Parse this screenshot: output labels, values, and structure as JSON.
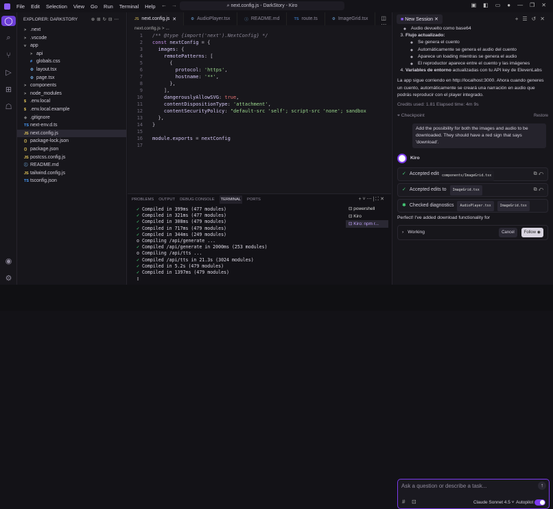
{
  "titlebar": {
    "menu": [
      "File",
      "Edit",
      "Selection",
      "View",
      "Go",
      "Run",
      "Terminal",
      "Help"
    ],
    "search": "next.config.js - DarkStory - Kiro"
  },
  "explorer": {
    "title": "EXPLORER: DARKSTORY",
    "items": [
      {
        "label": ".next",
        "icon": ">",
        "d": 0
      },
      {
        "label": ".vscode",
        "icon": ">",
        "d": 0
      },
      {
        "label": "app",
        "icon": "v",
        "d": 0
      },
      {
        "label": "api",
        "icon": ">",
        "d": 1
      },
      {
        "label": "globals.css",
        "icon": "#",
        "d": 1
      },
      {
        "label": "layout.tsx",
        "icon": "⚙",
        "d": 1
      },
      {
        "label": "page.tsx",
        "icon": "⚙",
        "d": 1
      },
      {
        "label": "components",
        "icon": ">",
        "d": 0
      },
      {
        "label": "node_modules",
        "icon": ">",
        "d": 0
      },
      {
        "label": ".env.local",
        "icon": "$",
        "d": 0
      },
      {
        "label": ".env.local.example",
        "icon": "$",
        "d": 0
      },
      {
        "label": ".gitignore",
        "icon": "◆",
        "d": 0
      },
      {
        "label": "next-env.d.ts",
        "icon": "TS",
        "d": 0
      },
      {
        "label": "next.config.js",
        "icon": "JS",
        "d": 0,
        "sel": true
      },
      {
        "label": "package-lock.json",
        "icon": "{}",
        "d": 0
      },
      {
        "label": "package.json",
        "icon": "{}",
        "d": 0
      },
      {
        "label": "postcss.config.js",
        "icon": "JS",
        "d": 0
      },
      {
        "label": "README.md",
        "icon": "ⓘ",
        "d": 0
      },
      {
        "label": "tailwind.config.js",
        "icon": "JS",
        "d": 0
      },
      {
        "label": "tsconfig.json",
        "icon": "TS",
        "d": 0
      }
    ]
  },
  "editor": {
    "tabs": [
      {
        "label": "next.config.js",
        "icon": "JS",
        "active": true
      },
      {
        "label": "AudioPlayer.tsx",
        "icon": "⚙"
      },
      {
        "label": "README.md",
        "icon": "ⓘ"
      },
      {
        "label": "route.ts",
        "icon": "TS"
      },
      {
        "label": "ImageGrid.tsx",
        "icon": "⚙"
      }
    ],
    "breadcrumb": "next.config.js > ...",
    "lines": [
      [
        [
          "c",
          "/** @type {import('next').NextConfig} */"
        ]
      ],
      [
        [
          "k",
          "const "
        ],
        [
          "v",
          "nextConfig "
        ],
        [
          "p",
          "= {"
        ]
      ],
      [
        [
          "p",
          "  "
        ],
        [
          "v",
          "images"
        ],
        [
          "p",
          ": {"
        ]
      ],
      [
        [
          "p",
          "    "
        ],
        [
          "v",
          "remotePatterns"
        ],
        [
          "p",
          ": ["
        ]
      ],
      [
        [
          "p",
          "      {"
        ]
      ],
      [
        [
          "p",
          "        "
        ],
        [
          "v",
          "protocol"
        ],
        [
          "p",
          ": "
        ],
        [
          "s",
          "'https'"
        ],
        [
          "p",
          ","
        ]
      ],
      [
        [
          "p",
          "        "
        ],
        [
          "v",
          "hostname"
        ],
        [
          "p",
          ": "
        ],
        [
          "s",
          "'**'"
        ],
        [
          "p",
          ","
        ]
      ],
      [
        [
          "p",
          "      },"
        ]
      ],
      [
        [
          "p",
          "    ],"
        ]
      ],
      [
        [
          "p",
          "    "
        ],
        [
          "v",
          "dangerouslyAllowSVG"
        ],
        [
          "p",
          ": "
        ],
        [
          "b",
          "true"
        ],
        [
          "p",
          ","
        ]
      ],
      [
        [
          "p",
          "    "
        ],
        [
          "v",
          "contentDispositionType"
        ],
        [
          "p",
          ": "
        ],
        [
          "s",
          "'attachment'"
        ],
        [
          "p",
          ","
        ]
      ],
      [
        [
          "p",
          "    "
        ],
        [
          "v",
          "contentSecurityPolicy"
        ],
        [
          "p",
          ": "
        ],
        [
          "s",
          "\"default-src 'self'; script-src 'none'; sandbox"
        ]
      ],
      [
        [
          "p",
          "  },"
        ]
      ],
      [
        [
          "p",
          "}"
        ]
      ],
      [
        [
          "p",
          ""
        ]
      ],
      [
        [
          "v",
          "module.exports "
        ],
        [
          "p",
          "= "
        ],
        [
          "v",
          "nextConfig"
        ]
      ],
      [
        [
          "p",
          ""
        ]
      ]
    ]
  },
  "panel": {
    "tabs": [
      "PROBLEMS",
      "OUTPUT",
      "DEBUG CONSOLE",
      "TERMINAL",
      "PORTS"
    ],
    "active": "TERMINAL",
    "terminal": [
      [
        "✓",
        " Compiled in 399ms (477 modules)"
      ],
      [
        "✓",
        " Compiled in 321ms (477 modules)"
      ],
      [
        "✓",
        " Compiled in 308ms (479 modules)"
      ],
      [
        "✓",
        " Compiled in 717ms (479 modules)"
      ],
      [
        "✓",
        " Compiled in 344ms (249 modules)"
      ],
      [
        "o",
        " Compiling /api/generate ..."
      ],
      [
        "✓",
        " Compiled /api/generate in 2000ms (253 modules)"
      ],
      [
        "o",
        " Compiling /api/tts ..."
      ],
      [
        "✓",
        " Compiled /api/tts in 21.3s (3024 modules)"
      ],
      [
        "✓",
        " Compiled in 5.2s (479 modules)"
      ],
      [
        "✓",
        " Compiled in 1397ms (479 modules)"
      ]
    ],
    "terminals": [
      "powershell",
      "Kiro",
      "Kiro: npm r..."
    ]
  },
  "chat": {
    "session_tab": "New Session",
    "bullets1": [
      "Audio devuelto como base64"
    ],
    "step3": "Flujo actualizado:",
    "bullets3": [
      "Se genera el cuento",
      "Automáticamente se genera el audio del cuento",
      "Aparece un loading mientras se genera el audio",
      "El reproductor aparece entre el cuento y las imágenes"
    ],
    "step4_bold": "Variables de entorno",
    "step4_rest": " actualizadas con tu API key de ElevenLabs",
    "paragraph": "La app sigue corriendo en http://localhost:3000. Ahora cuando generes un cuento, automáticamente se creará una narración en audio que podrás reproducir con el player integrado.",
    "credits": "Credits used: 1.81   Elapsed time: 4m 9s",
    "checkpoint": "Checkpoint",
    "restore": "Restore",
    "user_msg": "Add the possibility for both the images and audio to be downloaded. They should have a red sign that says 'download'.",
    "agent": "Kiro",
    "accepted1": "Accepted edits",
    "tooltip": "components/ImageGrid.tsx",
    "accepted2": "Accepted edits to",
    "chip2": "ImageGrid.tsx",
    "checked": "Checked diagnostics",
    "chip3a": "AudioPlayer.tsx",
    "chip3b": "ImageGrid.tsx",
    "perfect": "Perfect! I've added download functionality for",
    "working": "Working",
    "cancel": "Cancel",
    "follow": "Follow",
    "placeholder": "Ask a question or describe a task...",
    "model": "Claude Sonnet 4.5",
    "autopilot": "Autopilot",
    "autopilot_on": true
  }
}
